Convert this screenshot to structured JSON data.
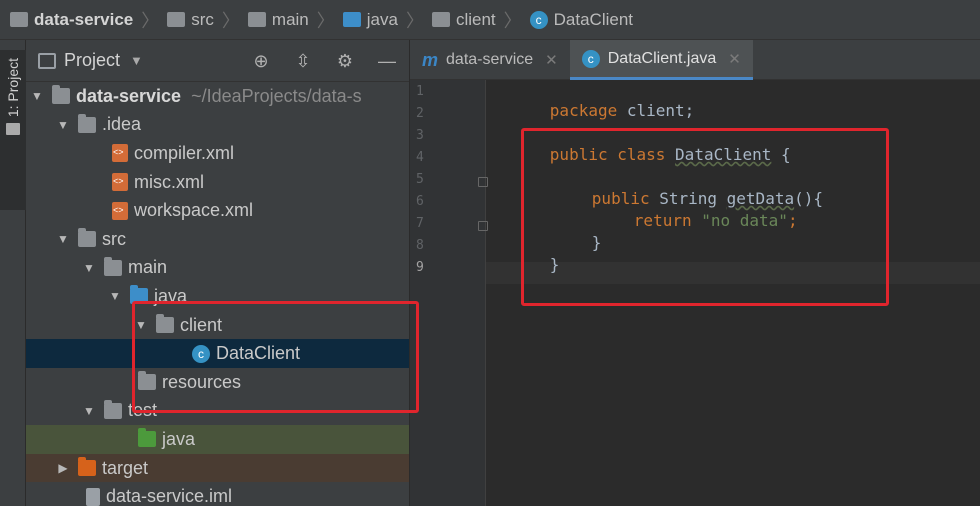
{
  "breadcrumb": {
    "items": [
      "data-service",
      "src",
      "main",
      "java",
      "client",
      "DataClient"
    ]
  },
  "tool_strip": {
    "label": "1: Project"
  },
  "project_panel": {
    "title": "Project",
    "dropdown": "▼"
  },
  "tree": {
    "root": {
      "name": "data-service",
      "path": "~/IdeaProjects/data-s"
    },
    "idea": ".idea",
    "compiler": "compiler.xml",
    "misc": "misc.xml",
    "workspace": "workspace.xml",
    "src": "src",
    "main": "main",
    "java": "java",
    "client": "client",
    "dataclient": "DataClient",
    "resources": "resources",
    "test": "test",
    "test_java": "java",
    "target": "target",
    "iml": "data-service.iml"
  },
  "editor": {
    "tabs": [
      {
        "icon": "m",
        "label": "data-service"
      },
      {
        "icon": "c",
        "label": "DataClient.java"
      }
    ],
    "line_numbers": [
      "1",
      "2",
      "3",
      "4",
      "5",
      "6",
      "7",
      "8",
      "9"
    ],
    "code": {
      "l1_kw": "package",
      "l1_rest": " client;",
      "l3_kw1": "public",
      "l3_kw2": "class",
      "l3_name": "DataClient",
      "l3_rest": " {",
      "l5_kw": "public",
      "l5_type": " String ",
      "l5_meth": "getData",
      "l5_rest": "(){",
      "l6_kw": "return",
      "l6_str": "\"no data\"",
      "l6_rest": ";",
      "l7": "}",
      "l8": "}"
    }
  },
  "colors": {
    "keyword": "#cc7832",
    "string": "#6a8759",
    "annotation": "#e0252d",
    "selection": "#0d293e"
  }
}
